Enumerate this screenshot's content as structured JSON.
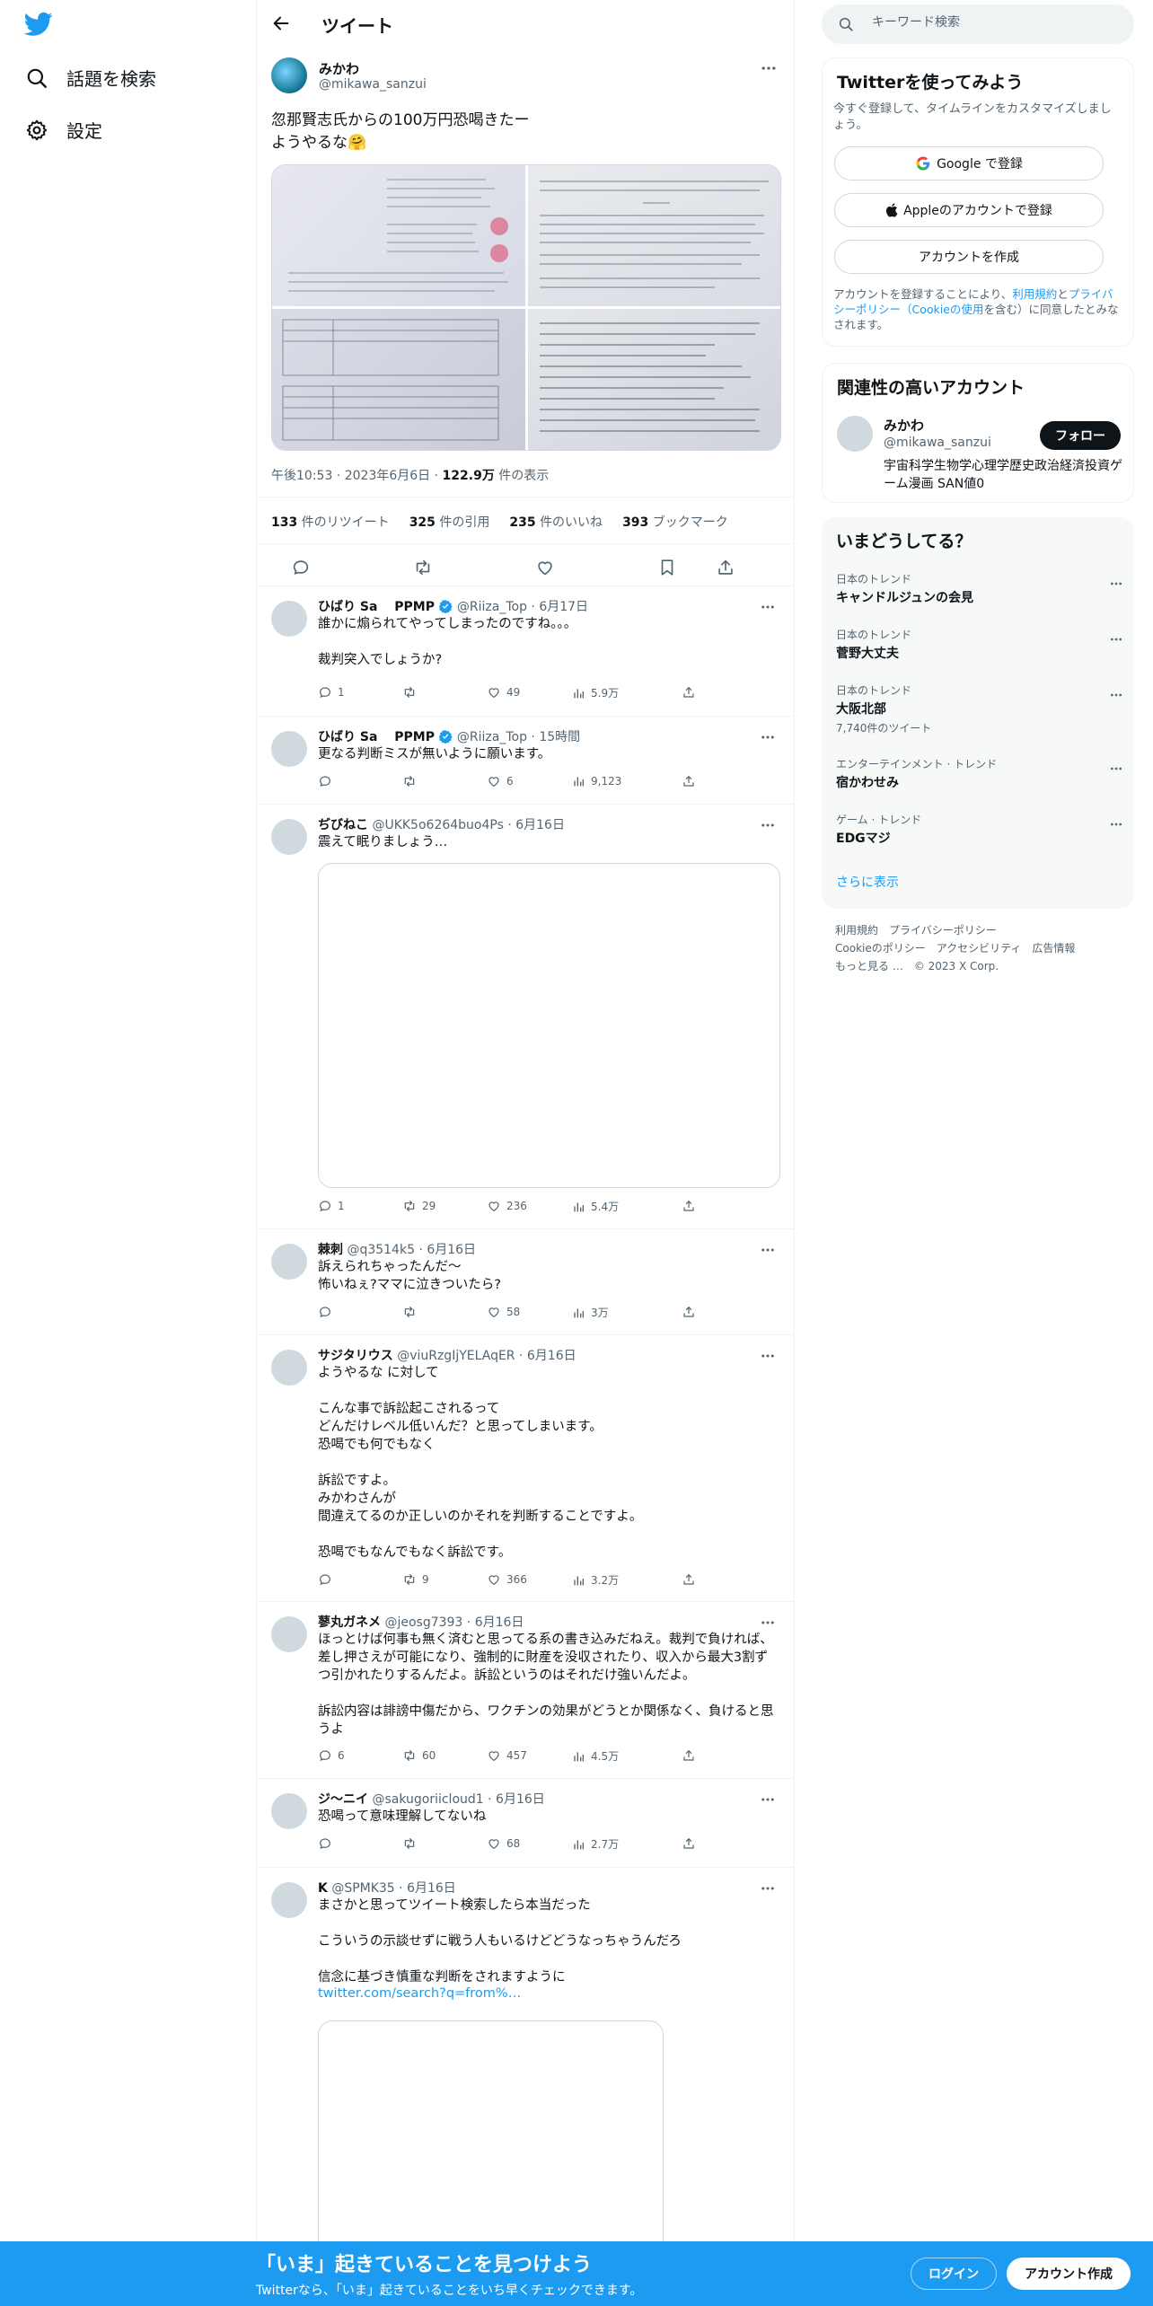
{
  "colors": {
    "brand": "#1d9bf0",
    "text": "#0f1419",
    "muted": "#536471"
  },
  "nav": {
    "logo_icon": "twitter-bird-icon",
    "explore_label": "話題を検索",
    "settings_label": "設定"
  },
  "header": {
    "title": "ツイート"
  },
  "main_tweet": {
    "name": "みかわ",
    "handle": "@mikawa_sanzui",
    "text": "忽那賢志氏からの100万円恐喝きたー\nようやるな🤗",
    "time": "午後10:53",
    "sep1": "·",
    "date": "2023年6月6日",
    "sep2": "·",
    "views": "122.9万",
    "views_label": "件の表示",
    "retweets": "133",
    "retweets_label": "件のリツイート",
    "quotes": "325",
    "quotes_label": "件の引用",
    "likes": "235",
    "likes_label": "件のいいね",
    "bookmarks": "393",
    "bookmarks_label": "ブックマーク"
  },
  "replies": [
    {
      "name": "ひばり Sa　 PPMP",
      "handle": "@Riiza_Top",
      "date": "· 6月17日",
      "text": "誰かに煽られてやってしまったのですね。。。\n\n裁判突入でしょうか?",
      "reply_count": "1",
      "retweet_count": "",
      "like_count": "49",
      "view_count": "5.9万"
    },
    {
      "name": "ひばり Sa　 PPMP",
      "handle": "@Riiza_Top",
      "date": "· 15時間",
      "text": "更なる判断ミスが無いように願います。",
      "reply_count": "",
      "retweet_count": "",
      "like_count": "6",
      "view_count": "9,123"
    },
    {
      "name": "ぢびねこ",
      "handle": "@UKK5o6264buo4Ps",
      "date": "· 6月16日",
      "text": "震えて眠りましょう…",
      "reply_count": "1",
      "retweet_count": "29",
      "like_count": "236",
      "view_count": "5.4万"
    },
    {
      "name": "棘刺",
      "handle": "@q3514k5",
      "date": "· 6月16日",
      "text": "訴えられちゃったんだ〜\n怖いねぇ?ママに泣きついたら?",
      "reply_count": "",
      "retweet_count": "",
      "like_count": "58",
      "view_count": "3万"
    },
    {
      "name": "サジタリウス",
      "handle": "@viuRzgIjYELAqER",
      "date": "· 6月16日",
      "text": "ようやるな に対して\n\nこんな事で訴訟起こされるって\nどんだけレベル低いんだ？と思ってしまいます。\n恐喝でも何でもなく\n\n訴訟ですよ。\nみかわさんが\n間違えてるのか正しいのかそれを判断することですよ。\n\n恐喝でもなんでもなく訴訟です。",
      "reply_count": "",
      "retweet_count": "9",
      "like_count": "366",
      "view_count": "3.2万"
    },
    {
      "name": "蓼丸ガネメ",
      "handle": "@jeosg7393",
      "date": "· 6月16日",
      "text": "ほっとけば何事も無く済むと思ってる系の書き込みだねえ。裁判で負ければ、差し押さえが可能になり、強制的に財産を没収されたり、収入から最大3割ずつ引かれたりするんだよ。訴訟というのはそれだけ強いんだよ。\n\n訴訟内容は誹謗中傷だから、ワクチンの効果がどうとか関係なく、負けると思うよ",
      "reply_count": "6",
      "retweet_count": "60",
      "like_count": "457",
      "view_count": "4.5万"
    },
    {
      "name": "ジ〜ニイ",
      "handle": "@sakugoriicloud1",
      "date": "· 6月16日",
      "text": "恐喝って意味理解してないね",
      "reply_count": "",
      "retweet_count": "",
      "like_count": "68",
      "view_count": "2.7万"
    },
    {
      "name": "K",
      "handle": "@SPMK35",
      "date": "· 6月16日",
      "text": "まさかと思ってツイート検索したら本当だった\n\nこういうの示談せずに戦う人もいるけどどうなっちゃうんだろ\n\n信念に基づき慎重な判断をされますように",
      "link": "twitter.com/search?q=from%…"
    }
  ],
  "sidebar": {
    "search_placeholder": "キーワード検索",
    "signup_card": {
      "title": "Twitterを使ってみよう",
      "subtitle": "今すぐ登録して、タイムラインをカスタマイズしましょう。",
      "google_label": "Google で登録",
      "apple_label": "Appleのアカウントで登録",
      "create_label": "アカウントを作成",
      "terms_prefix": "アカウントを登録することにより、",
      "terms_link1": "利用規約",
      "terms_mid": "と",
      "terms_link2": "プライバシーポリシー（Cookieの使用",
      "terms_suffix": "を含む）に同意したとみなされます。"
    },
    "related_card": {
      "title": "関連性の高いアカウント",
      "name": "みかわ",
      "handle": "@mikawa_sanzui",
      "follow_label": "フォロー",
      "bio": "宇宙科学生物学心理学歴史政治経済投資ゲーム漫画 SAN値0"
    },
    "trends": {
      "title": "いまどうしてる？",
      "items": [
        {
          "category": "日本のトレンド",
          "name": "キャンドルジュンの会見",
          "count": ""
        },
        {
          "category": "日本のトレンド",
          "name": "菅野大丈夫",
          "count": ""
        },
        {
          "category": "日本のトレンド",
          "name": "大阪北部",
          "count": "7,740件のツイート"
        },
        {
          "category": "エンターテインメント · トレンド",
          "name": "宿かわせみ",
          "count": ""
        },
        {
          "category": "ゲーム · トレンド",
          "name": "EDGマジ",
          "count": ""
        }
      ],
      "show_more": "さらに表示"
    },
    "footer": {
      "terms": "利用規約",
      "privacy": "プライバシーポリシー",
      "cookie": "Cookieのポリシー",
      "accessibility": "アクセシビリティ",
      "ads": "広告情報",
      "more": "もっと見る …",
      "copyright": "© 2023 X Corp."
    }
  },
  "banner": {
    "title": "「いま」起きていることを見つけよう",
    "subtitle": "Twitterなら、「いま」起きていることをいち早くチェックできます。",
    "login_label": "ログイン",
    "signup_label": "アカウント作成"
  }
}
